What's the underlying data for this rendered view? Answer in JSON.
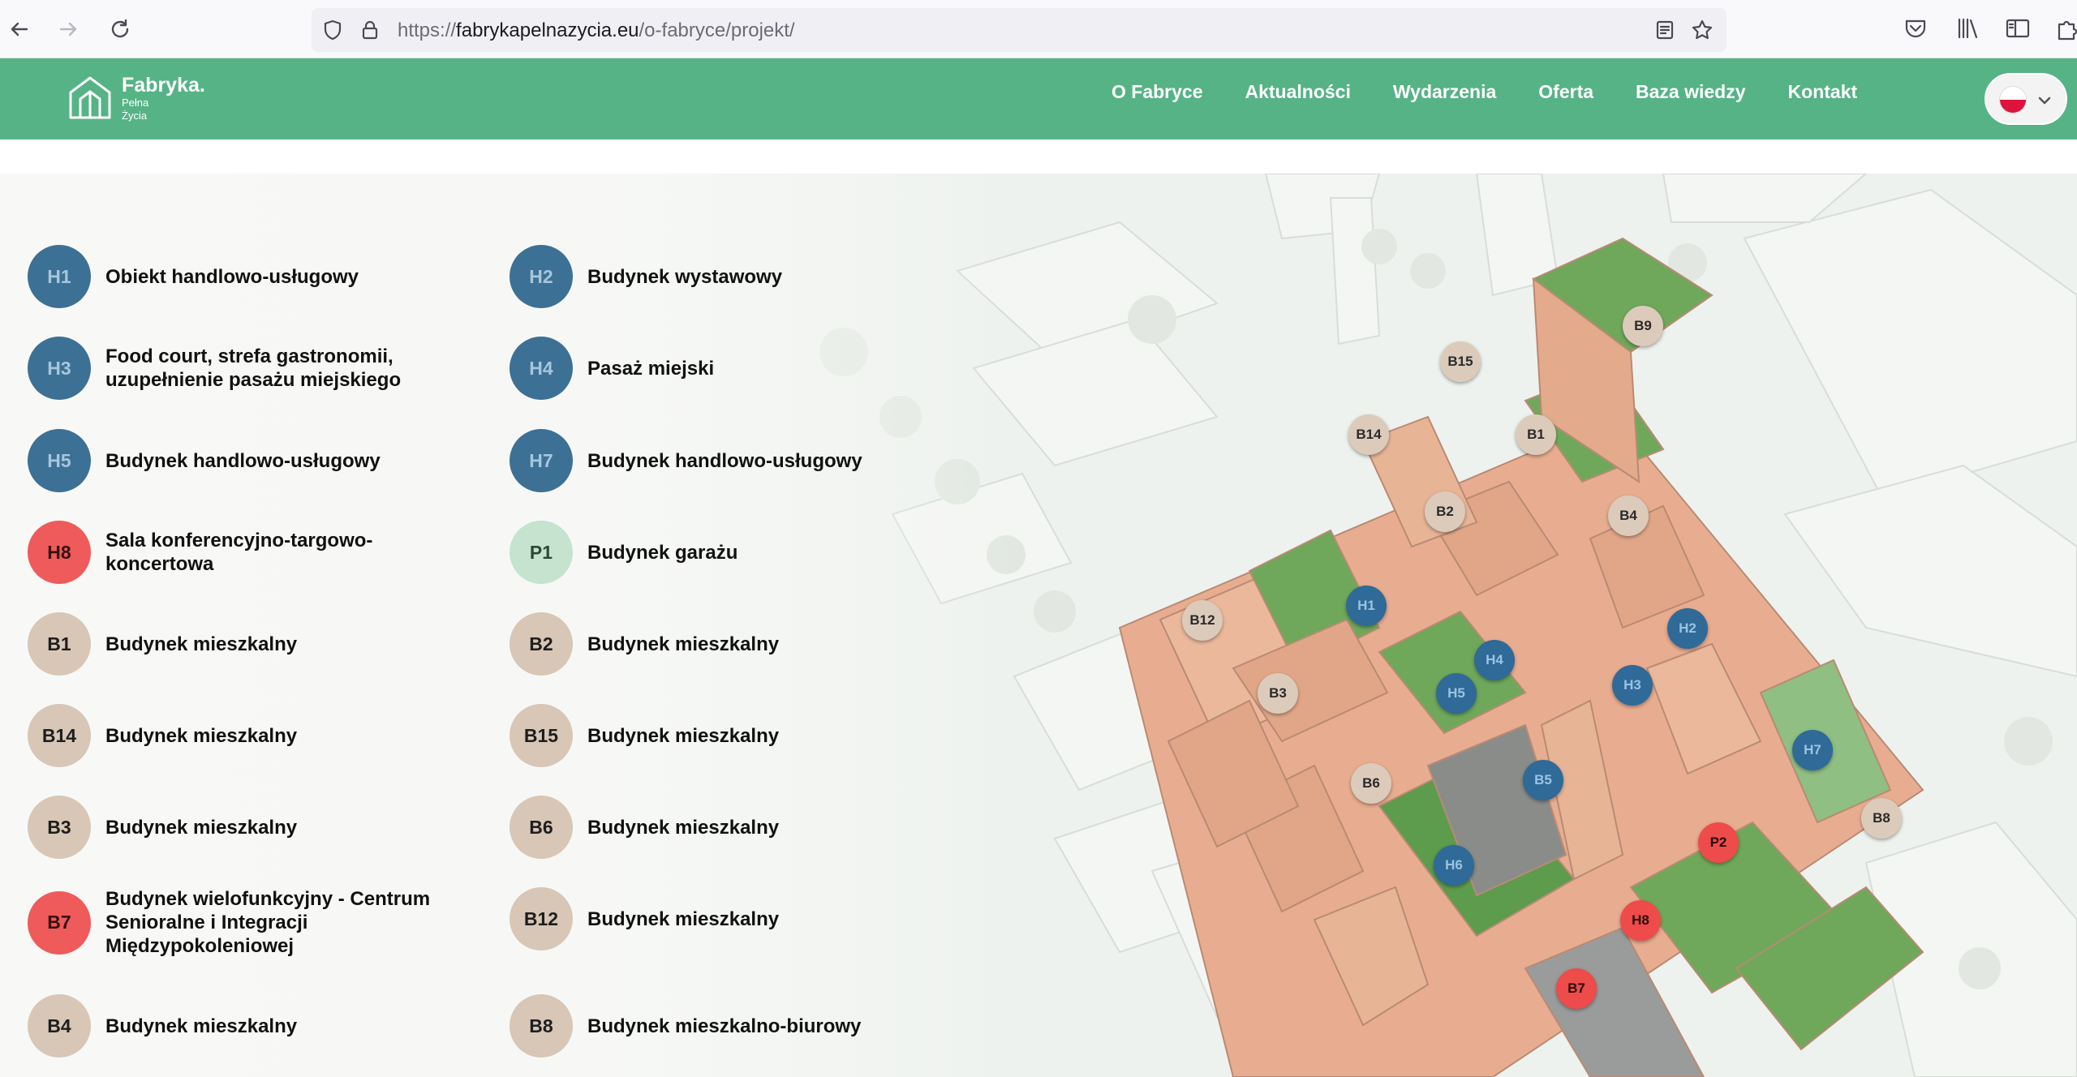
{
  "browser": {
    "url_host": "fabrykapelnazycia.eu",
    "url_prefix": "https://",
    "url_path": "/o-fabryce/projekt/"
  },
  "header": {
    "logo_title": "Fabryka.",
    "logo_sub_1": "Pełna",
    "logo_sub_2": "Życia",
    "nav": [
      "O Fabryce",
      "Aktualności",
      "Wydarzenia",
      "Oferta",
      "Baza wiedzy",
      "Kontakt"
    ]
  },
  "legend": [
    {
      "code": "H1",
      "label": "Obiekt handlowo-usługowy",
      "color": "blue"
    },
    {
      "code": "H2",
      "label": "Budynek wystawowy",
      "color": "blue"
    },
    {
      "code": "H3",
      "label": "Food court, strefa gastronomii, uzupełnienie pasażu miejskiego",
      "color": "blue"
    },
    {
      "code": "H4",
      "label": "Pasaż miejski",
      "color": "blue"
    },
    {
      "code": "H5",
      "label": "Budynek handlowo-usługowy",
      "color": "blue"
    },
    {
      "code": "H7",
      "label": "Budynek handlowo-usługowy",
      "color": "blue"
    },
    {
      "code": "H8",
      "label": "Sala konferencyjno-targowo-koncertowa",
      "color": "red"
    },
    {
      "code": "P1",
      "label": "Budynek garażu",
      "color": "green"
    },
    {
      "code": "B1",
      "label": "Budynek mieszkalny",
      "color": "tan"
    },
    {
      "code": "B2",
      "label": "Budynek mieszkalny",
      "color": "tan"
    },
    {
      "code": "B14",
      "label": "Budynek mieszkalny",
      "color": "tan"
    },
    {
      "code": "B15",
      "label": "Budynek mieszkalny",
      "color": "tan"
    },
    {
      "code": "B3",
      "label": "Budynek mieszkalny",
      "color": "tan"
    },
    {
      "code": "B6",
      "label": "Budynek mieszkalny",
      "color": "tan"
    },
    {
      "code": "B7",
      "label": "Budynek wielofunkcyjny - Centrum Senioralne i Integracji Międzypokoleniowej",
      "color": "red"
    },
    {
      "code": "B12",
      "label": "Budynek mieszkalny",
      "color": "tan"
    },
    {
      "code": "B4",
      "label": "Budynek mieszkalny",
      "color": "tan"
    },
    {
      "code": "B8",
      "label": "Budynek mieszkalno-biurowy",
      "color": "tan"
    }
  ],
  "map_pins": [
    "B9",
    "B15",
    "B14",
    "B1",
    "B2",
    "B4",
    "B12",
    "H1",
    "H2",
    "H4",
    "H3",
    "B3",
    "H5",
    "H7",
    "B5",
    "B6",
    "B8",
    "P2",
    "H6",
    "H8",
    "B7"
  ],
  "colors": {
    "header_green": "#56b386",
    "pin_blue": "#2f6a98",
    "pin_red": "#ee4b4b",
    "pin_tan": "#dccbbb",
    "roof_green": "#6fa85a",
    "brick": "#e6a98a"
  },
  "icons": [
    "back-icon",
    "forward-icon",
    "reload-icon",
    "shield-icon",
    "lock-icon",
    "reader-view-icon",
    "bookmark-star-icon",
    "pocket-icon",
    "library-icon",
    "sidebar-icon",
    "extensions-icon",
    "logo-icon",
    "chevron-down-icon"
  ]
}
